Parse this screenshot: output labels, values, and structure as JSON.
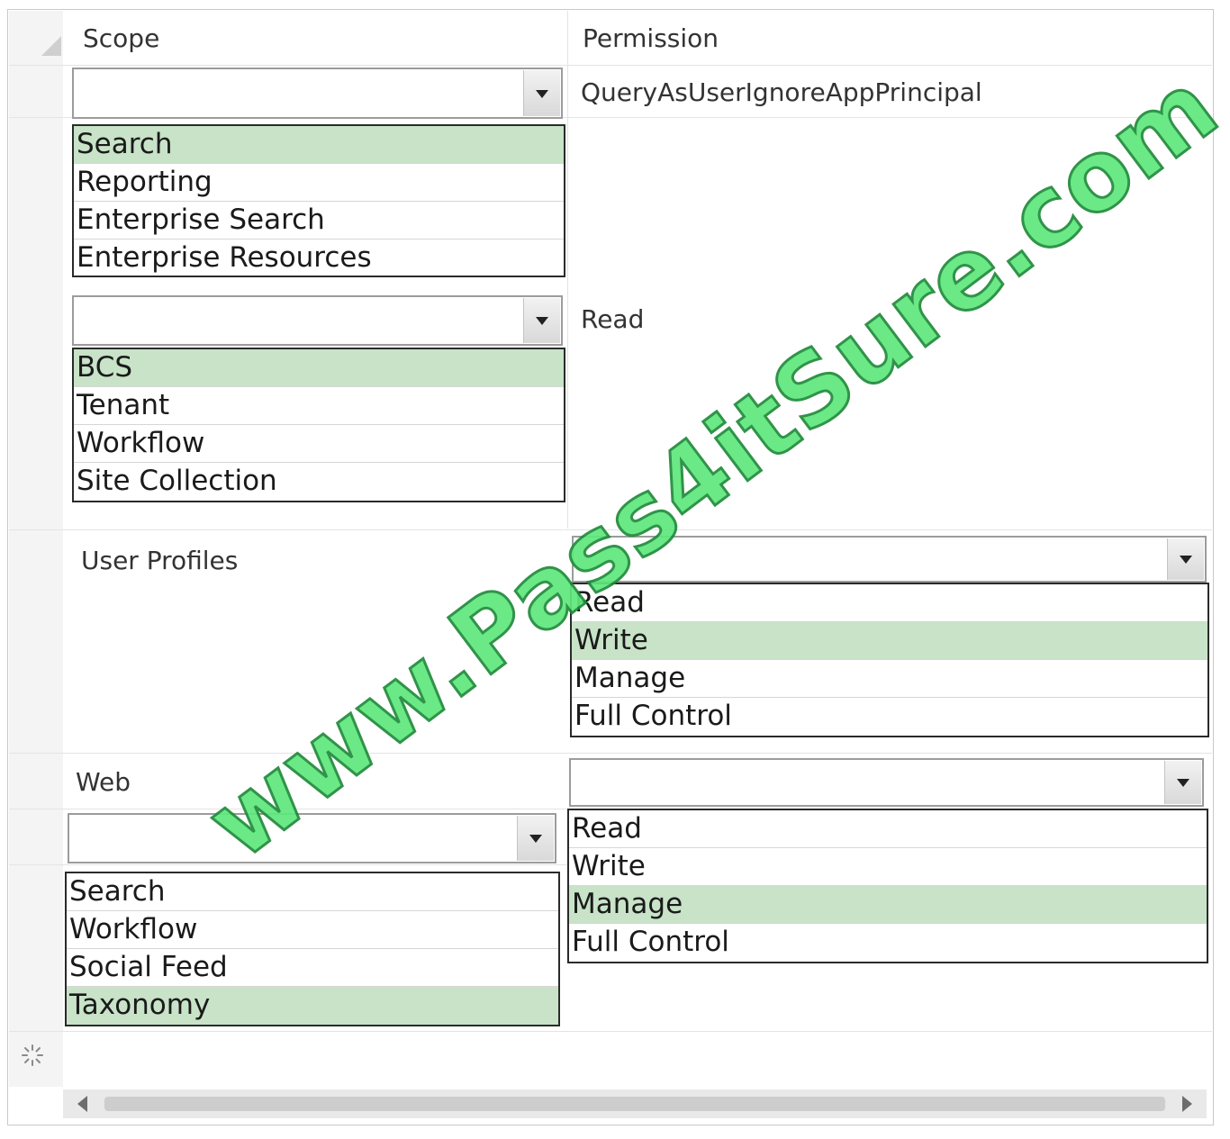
{
  "headers": {
    "scope": "Scope",
    "permission": "Permission"
  },
  "rows": {
    "row1": {
      "permission_text": "QueryAsUserIgnoreAppPrincipal",
      "scope_options": [
        {
          "label": "Search",
          "selected": true
        },
        {
          "label": "Reporting",
          "selected": false
        },
        {
          "label": "Enterprise Search",
          "selected": false
        },
        {
          "label": "Enterprise Resources",
          "selected": false
        }
      ]
    },
    "row2": {
      "permission_text": "Read",
      "scope_options": [
        {
          "label": "BCS",
          "selected": true
        },
        {
          "label": "Tenant",
          "selected": false
        },
        {
          "label": "Workflow",
          "selected": false
        },
        {
          "label": "Site Collection",
          "selected": false
        }
      ]
    },
    "row3": {
      "scope_text": "User Profiles",
      "permission_options": [
        {
          "label": "Read",
          "selected": false
        },
        {
          "label": "Write",
          "selected": true
        },
        {
          "label": "Manage",
          "selected": false
        },
        {
          "label": "Full Control",
          "selected": false
        }
      ]
    },
    "row4": {
      "scope_text": "Web",
      "permission_options": [
        {
          "label": "Read",
          "selected": false
        },
        {
          "label": "Write",
          "selected": false
        },
        {
          "label": "Manage",
          "selected": true
        },
        {
          "label": "Full Control",
          "selected": false
        }
      ]
    },
    "row5": {
      "scope_options": [
        {
          "label": "Search",
          "selected": false
        },
        {
          "label": "Workflow",
          "selected": false
        },
        {
          "label": "Social Feed",
          "selected": false
        },
        {
          "label": "Taxonomy",
          "selected": true
        }
      ]
    }
  },
  "watermark": "www.Pass4itSure.com",
  "colors": {
    "selected_option": "#c8e3c8",
    "watermark_fill": "#5ee87c",
    "watermark_stroke": "#1f8a3a"
  }
}
